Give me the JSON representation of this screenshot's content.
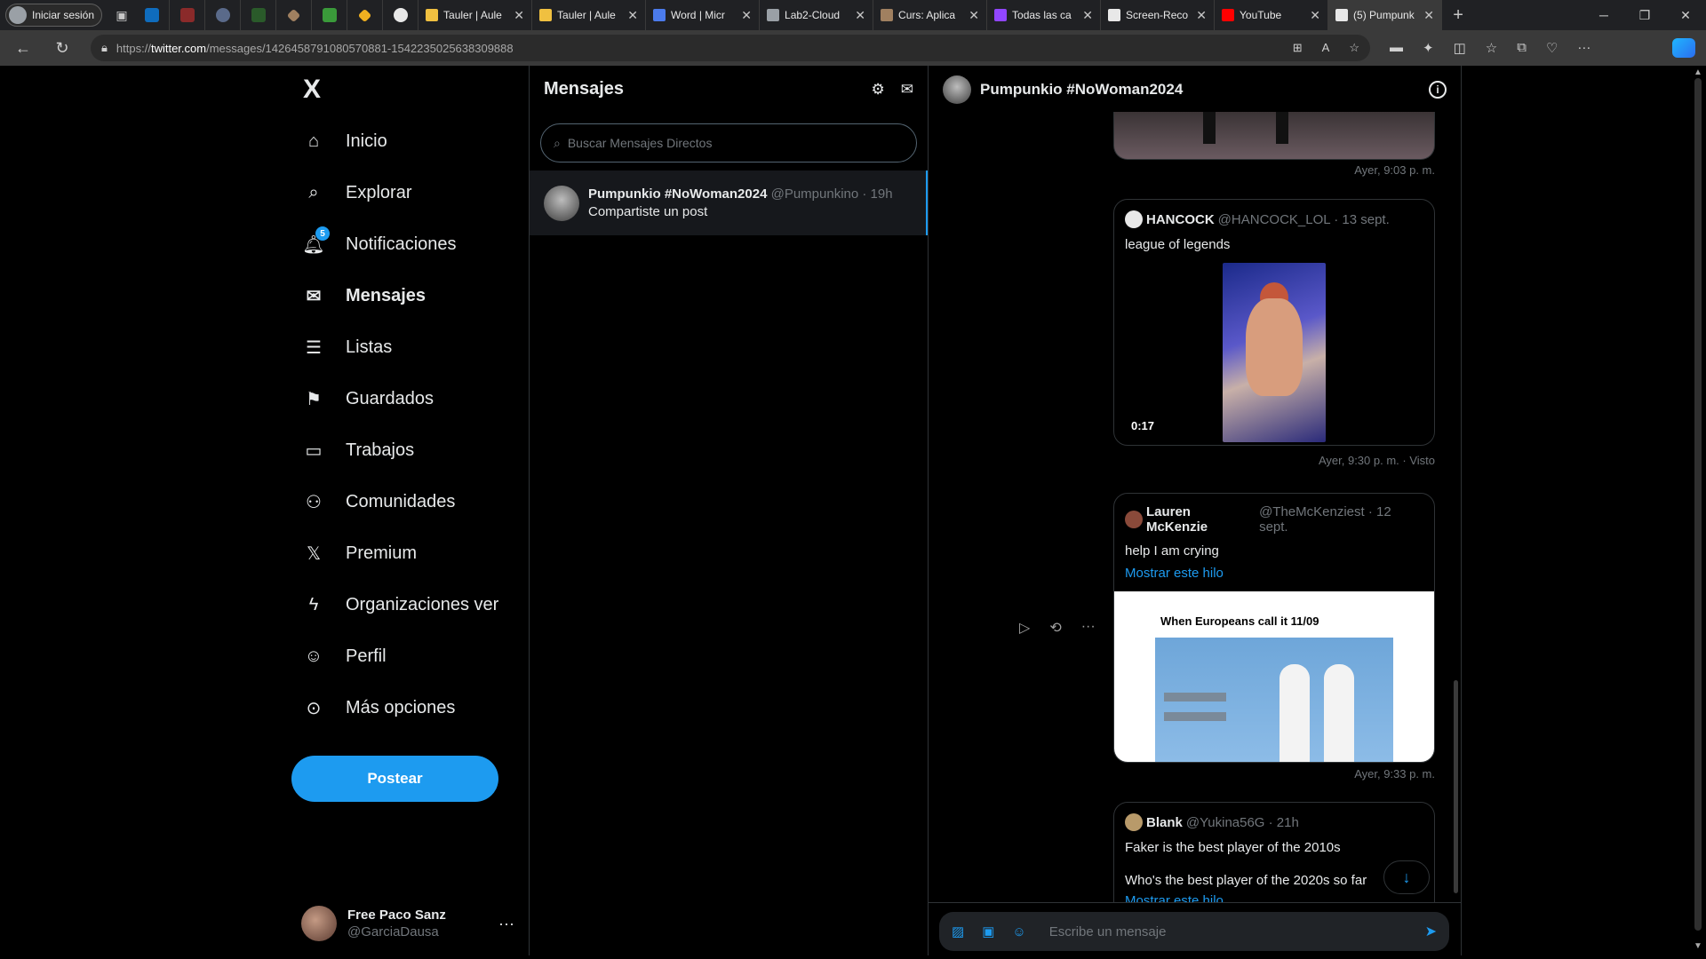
{
  "browser": {
    "profile_label": "Iniciar sesión",
    "tabs": [
      {
        "title": "Tauler | Aule",
        "color": "#f0c040"
      },
      {
        "title": "Tauler | Aule",
        "color": "#f0c040"
      },
      {
        "title": "Word | Micr",
        "color": "#4b7bec"
      },
      {
        "title": "Lab2-Cloud",
        "color": "#9aa0a6"
      },
      {
        "title": "Curs: Aplica",
        "color": "#a08060"
      },
      {
        "title": "Todas las ca",
        "color": "#9146ff"
      },
      {
        "title": "Screen-Reco",
        "color": "#e8e8e8"
      },
      {
        "title": "YouTube",
        "color": "#ff0000"
      },
      {
        "title": "(5) Pumpunk",
        "color": "#e8e8e8"
      }
    ],
    "url_prefix": "https://",
    "url_domain": "twitter.com",
    "url_path": "/messages/1426458791080570881-1542235025638309888"
  },
  "sidebar": {
    "logo": "X",
    "items": [
      {
        "label": "Inicio",
        "icon": "home-icon"
      },
      {
        "label": "Explorar",
        "icon": "search-icon"
      },
      {
        "label": "Notificaciones",
        "icon": "bell-icon",
        "badge": "5"
      },
      {
        "label": "Mensajes",
        "icon": "mail-icon"
      },
      {
        "label": "Listas",
        "icon": "list-icon"
      },
      {
        "label": "Guardados",
        "icon": "bookmark-icon"
      },
      {
        "label": "Trabajos",
        "icon": "briefcase-icon"
      },
      {
        "label": "Comunidades",
        "icon": "people-icon"
      },
      {
        "label": "Premium",
        "icon": "x-logo-icon"
      },
      {
        "label": "Organizaciones ver",
        "icon": "lightning-icon"
      },
      {
        "label": "Perfil",
        "icon": "person-icon"
      },
      {
        "label": "Más opciones",
        "icon": "more-circle-icon"
      }
    ],
    "post_button": "Postear",
    "account": {
      "name": "Free Paco Sanz",
      "handle": "@GarciaDausa",
      "more": "···"
    }
  },
  "messages": {
    "title": "Mensajes",
    "search_placeholder": "Buscar Mensajes Directos",
    "conversations": [
      {
        "name": "Pumpunkio #NoWoman2024",
        "handle": "@Pumpunkino · 19h",
        "preview": "Compartiste un post"
      }
    ]
  },
  "chat": {
    "title": "Pumpunkio #NoWoman2024",
    "stamp1": "Ayer, 9:03 p. m.",
    "card1": {
      "name": "HANCOCK",
      "meta": "@HANCOCK_LOL · 13 sept.",
      "text": "league of legends",
      "duration": "0:17"
    },
    "stamp2": "Ayer, 9:30 p. m. · Visto",
    "card2": {
      "name": "Lauren McKenzie",
      "meta": "@TheMcKenziest · 12 sept.",
      "text": "help I am crying",
      "link": "Mostrar este hilo",
      "meme_caption": "When Europeans call it 11/09"
    },
    "stamp3": "Ayer, 9:33 p. m.",
    "card3": {
      "name": "Blank",
      "meta": "@Yukina56G · 21h",
      "text1": "Faker is the best player of the 2010s",
      "text2": "Who's the best player of the 2020s so far",
      "link": "Mostrar este hilo"
    },
    "composer_placeholder": "Escribe un mensaje"
  }
}
